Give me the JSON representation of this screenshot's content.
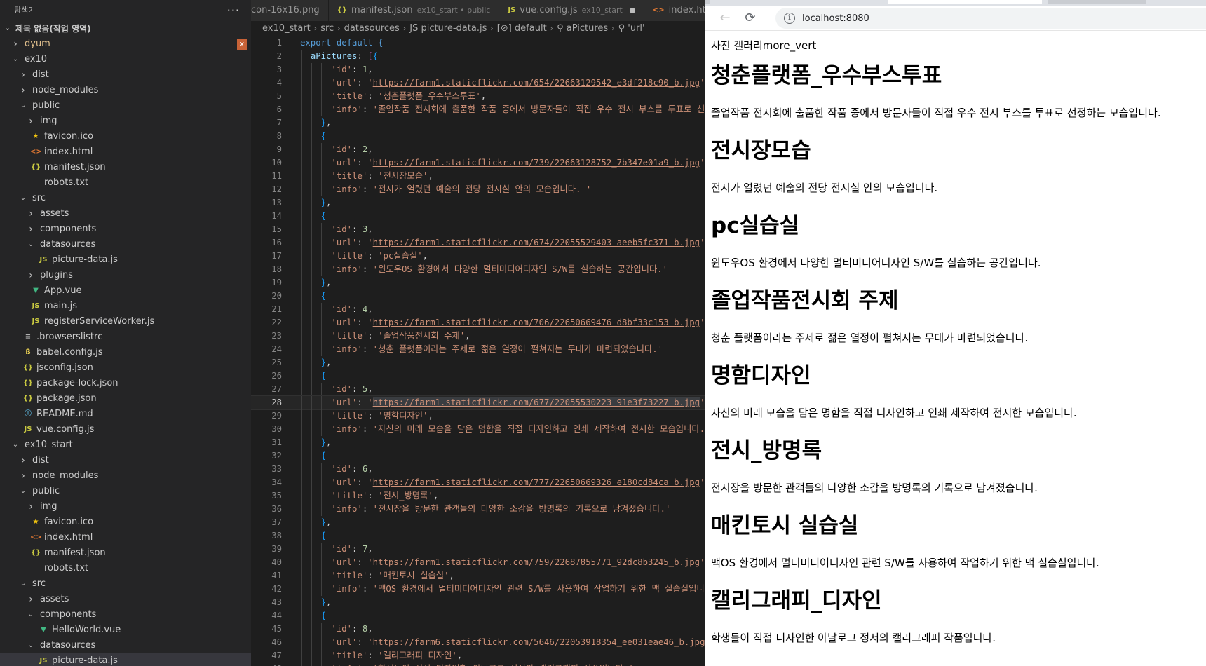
{
  "explorer": {
    "header": "탐색기",
    "more": "···",
    "workspace": "제목 없음(작업 영역)",
    "close_mark": "x",
    "items": [
      {
        "label": "dyum",
        "depth": 1,
        "kind": "folder",
        "open": false,
        "icon": "folder"
      },
      {
        "label": "ex10",
        "depth": 1,
        "kind": "folder",
        "open": true,
        "icon": "folder"
      },
      {
        "label": "dist",
        "depth": 2,
        "kind": "folder",
        "open": false,
        "icon": "folder"
      },
      {
        "label": "node_modules",
        "depth": 2,
        "kind": "folder",
        "open": false,
        "icon": "folder"
      },
      {
        "label": "public",
        "depth": 2,
        "kind": "folder",
        "open": true,
        "icon": "folder"
      },
      {
        "label": "img",
        "depth": 3,
        "kind": "folder",
        "open": false,
        "icon": "folder"
      },
      {
        "label": "favicon.ico",
        "depth": 3,
        "kind": "file",
        "icon": "star"
      },
      {
        "label": "index.html",
        "depth": 3,
        "kind": "file",
        "icon": "html"
      },
      {
        "label": "manifest.json",
        "depth": 3,
        "kind": "file",
        "icon": "json"
      },
      {
        "label": "robots.txt",
        "depth": 3,
        "kind": "file",
        "icon": "txt"
      },
      {
        "label": "src",
        "depth": 2,
        "kind": "folder",
        "open": true,
        "icon": "folder"
      },
      {
        "label": "assets",
        "depth": 3,
        "kind": "folder",
        "open": false,
        "icon": "folder"
      },
      {
        "label": "components",
        "depth": 3,
        "kind": "folder",
        "open": false,
        "icon": "folder"
      },
      {
        "label": "datasources",
        "depth": 3,
        "kind": "folder",
        "open": true,
        "icon": "folder"
      },
      {
        "label": "picture-data.js",
        "depth": 4,
        "kind": "file",
        "icon": "js"
      },
      {
        "label": "plugins",
        "depth": 3,
        "kind": "folder",
        "open": false,
        "icon": "folder"
      },
      {
        "label": "App.vue",
        "depth": 3,
        "kind": "file",
        "icon": "vue"
      },
      {
        "label": "main.js",
        "depth": 3,
        "kind": "file",
        "icon": "js"
      },
      {
        "label": "registerServiceWorker.js",
        "depth": 3,
        "kind": "file",
        "icon": "js"
      },
      {
        "label": ".browserslistrc",
        "depth": 2,
        "kind": "file",
        "icon": "eq"
      },
      {
        "label": "babel.config.js",
        "depth": 2,
        "kind": "file",
        "icon": "babel"
      },
      {
        "label": "jsconfig.json",
        "depth": 2,
        "kind": "file",
        "icon": "json"
      },
      {
        "label": "package-lock.json",
        "depth": 2,
        "kind": "file",
        "icon": "json"
      },
      {
        "label": "package.json",
        "depth": 2,
        "kind": "file",
        "icon": "json"
      },
      {
        "label": "README.md",
        "depth": 2,
        "kind": "file",
        "icon": "info"
      },
      {
        "label": "vue.config.js",
        "depth": 2,
        "kind": "file",
        "icon": "js"
      },
      {
        "label": "ex10_start",
        "depth": 1,
        "kind": "folder",
        "open": true,
        "icon": "folder"
      },
      {
        "label": "dist",
        "depth": 2,
        "kind": "folder",
        "open": false,
        "icon": "folder"
      },
      {
        "label": "node_modules",
        "depth": 2,
        "kind": "folder",
        "open": false,
        "icon": "folder"
      },
      {
        "label": "public",
        "depth": 2,
        "kind": "folder",
        "open": true,
        "icon": "folder"
      },
      {
        "label": "img",
        "depth": 3,
        "kind": "folder",
        "open": false,
        "icon": "folder"
      },
      {
        "label": "favicon.ico",
        "depth": 3,
        "kind": "file",
        "icon": "star"
      },
      {
        "label": "index.html",
        "depth": 3,
        "kind": "file",
        "icon": "html"
      },
      {
        "label": "manifest.json",
        "depth": 3,
        "kind": "file",
        "icon": "json"
      },
      {
        "label": "robots.txt",
        "depth": 3,
        "kind": "file",
        "icon": "txt"
      },
      {
        "label": "src",
        "depth": 2,
        "kind": "folder",
        "open": true,
        "icon": "folder"
      },
      {
        "label": "assets",
        "depth": 3,
        "kind": "folder",
        "open": false,
        "icon": "folder"
      },
      {
        "label": "components",
        "depth": 3,
        "kind": "folder",
        "open": true,
        "icon": "folder"
      },
      {
        "label": "HelloWorld.vue",
        "depth": 4,
        "kind": "file",
        "icon": "vue"
      },
      {
        "label": "datasources",
        "depth": 3,
        "kind": "folder",
        "open": true,
        "icon": "folder"
      },
      {
        "label": "picture-data.js",
        "depth": 4,
        "kind": "file",
        "icon": "js",
        "selected": true
      }
    ]
  },
  "editor": {
    "tabs": [
      {
        "icon": "",
        "label": "con-16x16.png",
        "desc": ""
      },
      {
        "icon": "{}",
        "label": "manifest.json",
        "desc": "ex10_start • public"
      },
      {
        "icon": "JS",
        "label": "vue.config.js",
        "desc": "ex10_start",
        "dot": true
      },
      {
        "icon": "<>",
        "label": "index.html",
        "desc": ""
      }
    ],
    "breadcrumb": [
      "ex10_start",
      "src",
      "datasources",
      "JS picture-data.js",
      "[⊘] default",
      "⚲ aPictures",
      "⚲ 'url'"
    ],
    "active_line": 28
  },
  "code": {
    "export_line": "export default {",
    "array_key": "aPictures",
    "records": [
      {
        "id": "1",
        "url": "https://farm1.staticflickr.com/654/22663129542_e3df218c90_b.jpg",
        "title": "청춘플랫폼_우수부스투표",
        "info": "졸업작품 전시회에 출품한 작품 중에서 방문자들이 직접 우수 전시 부스를 투표로 선정하는 모습입니다."
      },
      {
        "id": "2",
        "url": "https://farm1.staticflickr.com/739/22663128752_7b347e01a9_b.jpg",
        "title": "전시장모습",
        "info": "전시가 열렸던 예술의 전당 전시실 안의 모습입니다. "
      },
      {
        "id": "3",
        "url": "https://farm1.staticflickr.com/674/22055529403_aeeb5fc371_b.jpg",
        "title": "pc실습실",
        "info": "윈도우OS 환경에서 다양한 멀티미디어디자인 S/W를 실습하는 공간입니다."
      },
      {
        "id": "4",
        "url": "https://farm1.staticflickr.com/706/22650669476_d8bf33c153_b.jpg",
        "title": "졸업작품전시회 주제",
        "info": "청춘 플랫폼이라는 주제로 젊은 열정이 펼쳐지는 무대가 마련되었습니다."
      },
      {
        "id": "5",
        "url": "https://farm1.staticflickr.com/677/22055530223_91e3f73227_b.jpg",
        "title": "명함디자인",
        "info": "자신의 미래 모습을 담은 명함을 직접 디자인하고 인쇄 제작하여 전시한 모습입니다."
      },
      {
        "id": "6",
        "url": "https://farm1.staticflickr.com/777/22650669326_e180cd84ca_b.jpg",
        "title": "전시_방명록",
        "info": "전시장을 방문한 관객들의 다양한 소감을 방명록의 기록으로 남겨졌습니다."
      },
      {
        "id": "7",
        "url": "https://farm1.staticflickr.com/759/22687855771_92dc8b3245_b.jpg",
        "title": "매킨토시 실습실",
        "info": "맥OS 환경에서 멀티미디어디자인 관련 S/W를 사용하여 작업하기 위한 맥 실습실입니다."
      },
      {
        "id": "8",
        "url": "https://farm6.staticflickr.com/5646/22053918354_ee031eae46_b.jpg",
        "title": "캘리그래피_디자인",
        "info": "학생들이 직접 디자인한 아날로그 정서의 캘리그래피 작품입니다."
      }
    ]
  },
  "browser": {
    "url": "localhost:8080",
    "back": "←",
    "reload": "⟳",
    "info": "i",
    "app_header": "사진 갤러리more_vert",
    "gallery": [
      {
        "title": "청춘플랫폼_우수부스투표",
        "info": "졸업작품 전시회에 출품한 작품 중에서 방문자들이 직접 우수 전시 부스를 투표로 선정하는 모습입니다."
      },
      {
        "title": "전시장모습",
        "info": "전시가 열렸던 예술의 전당 전시실 안의 모습입니다."
      },
      {
        "title": "pc실습실",
        "info": "윈도우OS 환경에서 다양한 멀티미디어디자인 S/W를 실습하는 공간입니다."
      },
      {
        "title": "졸업작품전시회 주제",
        "info": "청춘 플랫폼이라는 주제로 젊은 열정이 펼쳐지는 무대가 마련되었습니다."
      },
      {
        "title": "명함디자인",
        "info": "자신의 미래 모습을 담은 명함을 직접 디자인하고 인쇄 제작하여 전시한 모습입니다."
      },
      {
        "title": "전시_방명록",
        "info": "전시장을 방문한 관객들의 다양한 소감을 방명록의 기록으로 남겨졌습니다."
      },
      {
        "title": "매킨토시 실습실",
        "info": "맥OS 환경에서 멀티미디어디자인 관련 S/W를 사용하여 작업하기 위한 맥 실습실입니다."
      },
      {
        "title": "캘리그래피_디자인",
        "info": "학생들이 직접 디자인한 아날로그 정서의 캘리그래피 작품입니다."
      }
    ]
  }
}
